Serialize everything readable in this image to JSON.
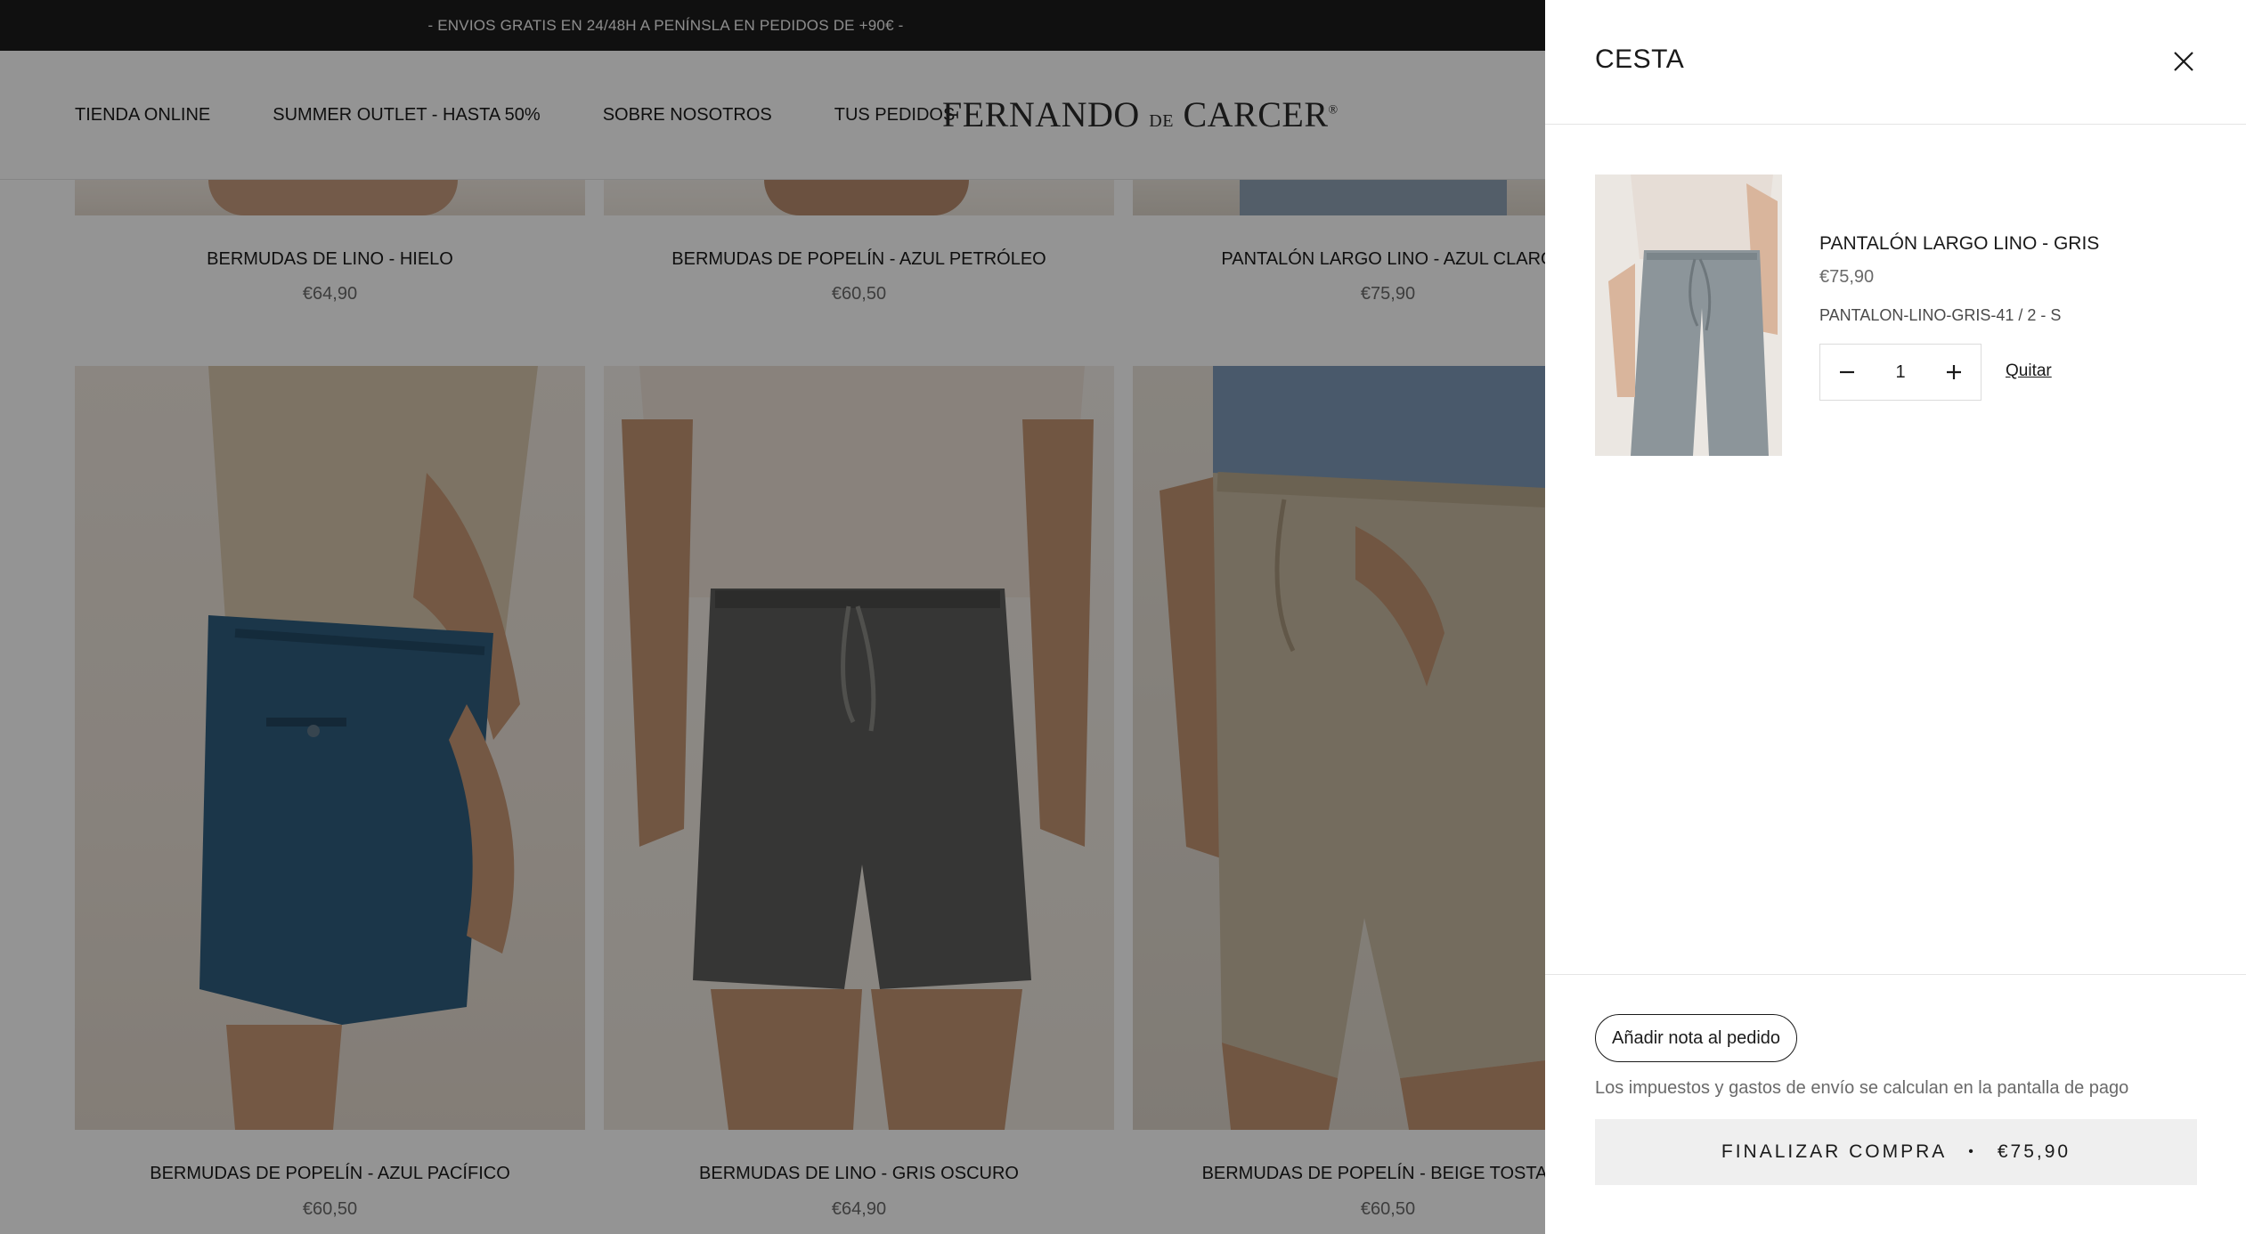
{
  "announcement": {
    "text": "- ENVIOS GRATIS EN 24/48H A PENÍNSLA EN PEDIDOS DE +90€ -"
  },
  "header": {
    "nav": [
      "TIENDA ONLINE",
      "SUMMER OUTLET - HASTA 50%",
      "SOBRE NOSOTROS",
      "TUS PEDIDOS"
    ],
    "logo": {
      "main1": "FERNANDO ",
      "de": "DE",
      "main2": " CARCER",
      "reg": "®"
    }
  },
  "products_row1": [
    {
      "title": "BERMUDAS DE LINO - HIELO",
      "price": "€64,90"
    },
    {
      "title": "BERMUDAS DE POPELÍN - AZUL PETRÓLEO",
      "price": "€60,50"
    },
    {
      "title": "PANTALÓN LARGO LINO - AZUL CLARO",
      "price": "€75,90"
    }
  ],
  "products_row2": [
    {
      "title": "BERMUDAS DE POPELÍN - AZUL PACÍFICO",
      "price": "€60,50"
    },
    {
      "title": "BERMUDAS DE LINO - GRIS OSCURO",
      "price": "€64,90"
    },
    {
      "title": "BERMUDAS DE POPELÍN - BEIGE TOSTADO",
      "price": "€60,50"
    }
  ],
  "cart": {
    "title": "CESTA",
    "item": {
      "name": "PANTALÓN LARGO LINO - GRIS",
      "price": "€75,90",
      "variant": "PANTALON-LINO-GRIS-41 / 2 - S",
      "quantity": "1",
      "remove_label": "Quitar"
    },
    "note_button": "Añadir nota al pedido",
    "tax_note": "Los impuestos y gastos de envío se calculan en la pantalla de pago",
    "checkout_label": "FINALIZAR COMPRA",
    "checkout_sep": "•",
    "checkout_total": "€75,90"
  },
  "colors": {
    "announcement_bg": "#1c1c1c",
    "overlay": "rgba(0,0,0,0.42)",
    "checkout_bg": "#efefef"
  }
}
